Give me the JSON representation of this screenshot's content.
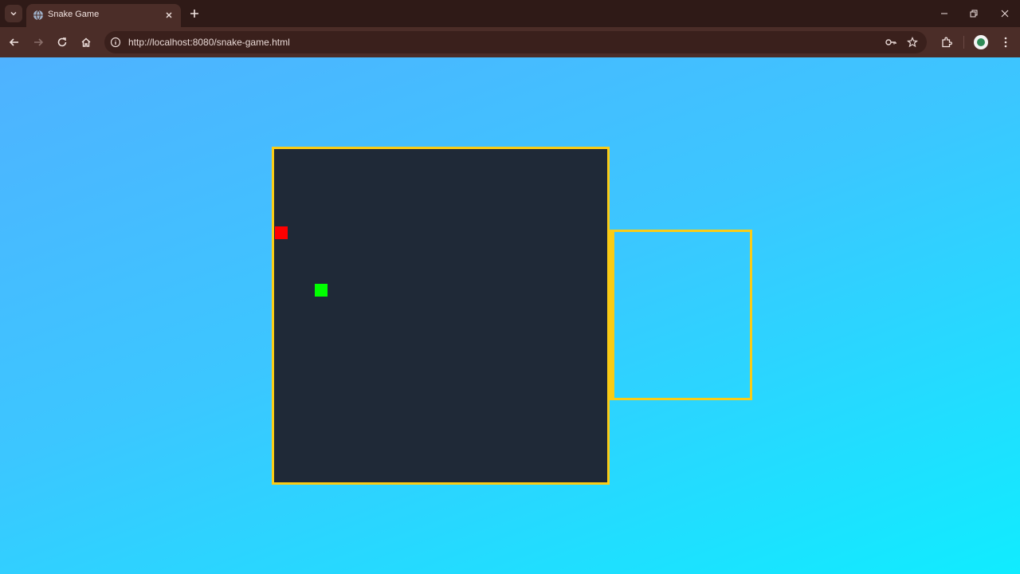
{
  "browser": {
    "tab": {
      "title": "Snake Game",
      "favicon": "globe-icon"
    },
    "address_bar": {
      "url": "http://localhost:8080/snake-game.html"
    },
    "icons": {
      "back": "arrow-left-icon",
      "forward": "arrow-right-icon",
      "reload": "reload-icon",
      "home": "home-icon",
      "site_info": "info-icon",
      "passwords": "key-icon",
      "bookmark": "star-icon",
      "extensions": "puzzle-icon",
      "menu": "kebab-menu-icon"
    }
  },
  "page": {
    "colors": {
      "background_start": "#4fb2ff",
      "background_end": "#10ecff",
      "board_background": "#1f2937",
      "border": "#facc15",
      "food": "#ff0000",
      "snake": "#00ff00"
    }
  },
  "game": {
    "grid_size": 26,
    "food": {
      "col": 0,
      "row": 6
    },
    "snake": [
      {
        "col": 3,
        "row": 11
      }
    ]
  }
}
